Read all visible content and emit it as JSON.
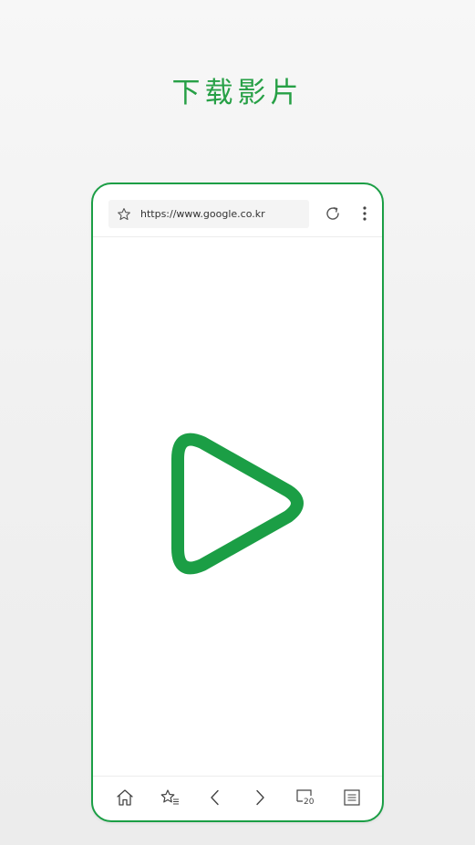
{
  "headline": "下载影片",
  "browser": {
    "url": "https://www.google.co.kr",
    "tab_count": "20"
  },
  "icons": {
    "bookmark": "star-icon",
    "reload": "reload-icon",
    "menu": "more-vert-icon",
    "play": "play-icon",
    "home": "home-icon",
    "bookmarks": "bookmarks-icon",
    "back": "back-icon",
    "forward": "forward-icon",
    "tabs": "tabs-icon",
    "list": "list-icon"
  },
  "colors": {
    "accent": "#1b9e45",
    "headline": "#27a046"
  }
}
